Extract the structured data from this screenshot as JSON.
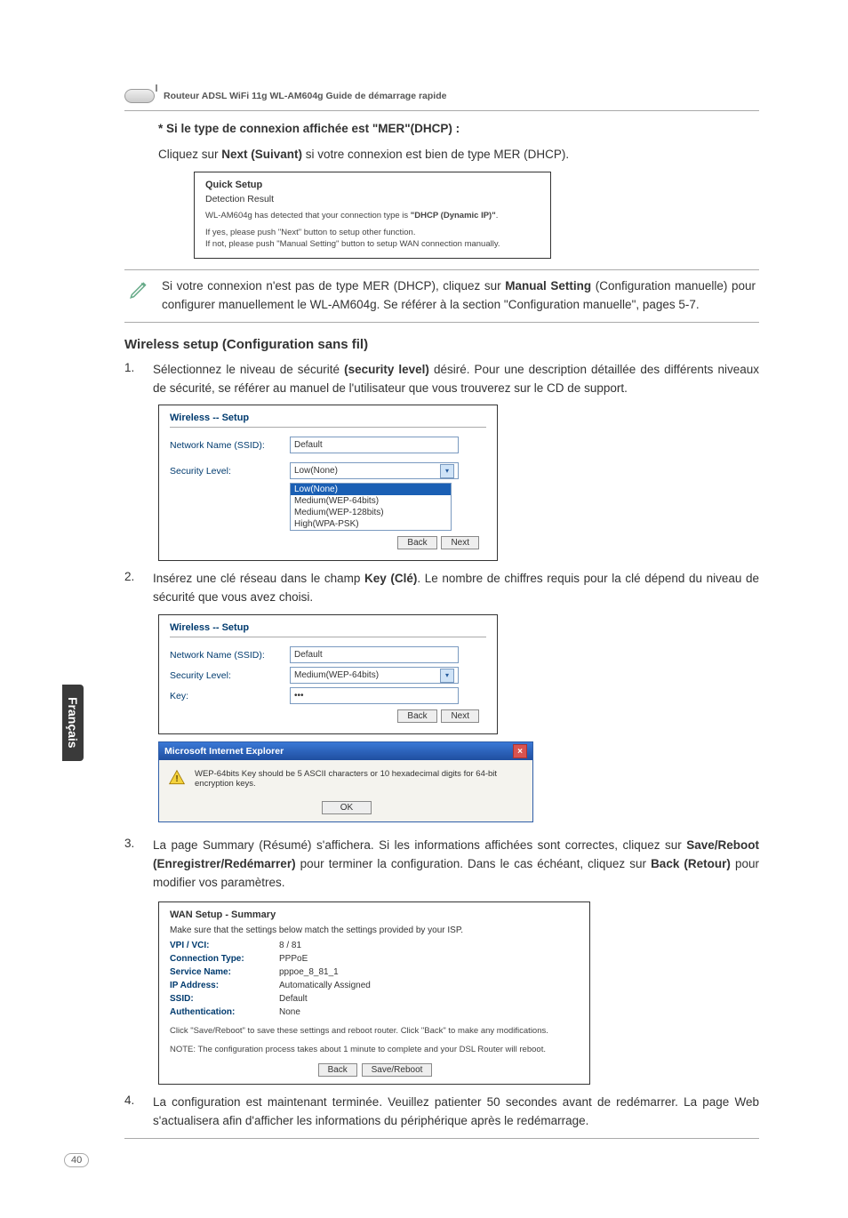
{
  "side_tab": "Français",
  "page_number": "40",
  "router_header": "Routeur ADSL WiFi 11g WL-AM604g Guide de démarrage rapide",
  "sec1": {
    "heading": "* Si le type de connexion affichée est  \"MER\"(DHCP) :",
    "line1_a": "Cliquez sur ",
    "line1_b": "Next (Suivant)",
    "line1_c": " si votre connexion est bien de type MER (DHCP)."
  },
  "qs1": {
    "title": "Quick Setup",
    "sub": "Detection Result",
    "msg_a": "WL-AM604g has detected that your connection type is ",
    "msg_b": "\"DHCP (Dynamic IP)\"",
    "msg_c": ".",
    "line2": "If yes, please push \"Next\" button to setup other function.",
    "line3": "If not, please push \"Manual Setting\" button to setup WAN connection manually."
  },
  "note1": {
    "t1": "Si votre connexion n'est pas de type MER (DHCP), cliquez sur ",
    "t2": "Manual Setting",
    "t3": " (Configuration manuelle) pour configurer manuellement le WL-AM604g. Se référer à la section \"Configuration manuelle\", pages 5-7."
  },
  "wsetup_heading": "Wireless setup (Configuration sans fil)",
  "step1": {
    "num": "1.",
    "t1": "Sélectionnez le niveau de sécurité ",
    "t2": "(security level)",
    "t3": " désiré. Pour une description détaillée des différents niveaux de sécurité, se référer au manuel de l'utilisateur que vous trouverez sur le CD de support."
  },
  "ws1": {
    "title": "Wireless -- Setup",
    "ssid_label": "Network Name (SSID):",
    "ssid_value": "Default",
    "seclevel_label": "Security Level:",
    "seclevel_value": "Low(None)",
    "opts": [
      "Low(None)",
      "Medium(WEP-64bits)",
      "Medium(WEP-128bits)",
      "High(WPA-PSK)"
    ],
    "back": "Back",
    "next": "Next"
  },
  "step2": {
    "num": "2.",
    "t1": "Insérez une clé réseau dans le champ ",
    "t2": "Key (Clé)",
    "t3": ". Le nombre de chiffres requis pour la clé dépend du niveau de sécurité que vous avez choisi."
  },
  "ws2": {
    "title": "Wireless -- Setup",
    "ssid_label": "Network Name (SSID):",
    "ssid_value": "Default",
    "seclevel_label": "Security Level:",
    "seclevel_value": "Medium(WEP-64bits)",
    "key_label": "Key:",
    "key_value": "•••",
    "back": "Back",
    "next": "Next"
  },
  "iedlg": {
    "title": "Microsoft Internet Explorer",
    "msg": "WEP-64bits Key should be 5 ASCII characters or 10 hexadecimal digits for 64-bit encryption keys.",
    "ok": "OK"
  },
  "step3": {
    "num": "3.",
    "t1": "La page Summary (Résumé) s'affichera. Si les informations affichées sont correctes, cliquez sur ",
    "t2": "Save/Reboot (Enregistrer/Redémarrer)",
    "t3": " pour terminer la configuration. Dans le cas échéant, cliquez sur ",
    "t4": "Back (Retour)",
    "t5": " pour modifier vos paramètres."
  },
  "summary": {
    "title": "WAN Setup - Summary",
    "intro": "Make sure that the settings below match the settings provided by your ISP.",
    "rows": [
      {
        "k": "VPI / VCI:",
        "v": "8 / 81"
      },
      {
        "k": "Connection Type:",
        "v": "PPPoE"
      },
      {
        "k": "Service Name:",
        "v": "pppoe_8_81_1"
      },
      {
        "k": "IP Address:",
        "v": "Automatically Assigned"
      },
      {
        "k": "SSID:",
        "v": "Default"
      },
      {
        "k": "Authentication:",
        "v": "None"
      }
    ],
    "note1": "Click \"Save/Reboot\" to save these settings and reboot router. Click \"Back\" to make any modifications.",
    "note2": "NOTE: The configuration process takes about 1 minute to complete and your DSL Router will reboot.",
    "back": "Back",
    "save": "Save/Reboot"
  },
  "step4": {
    "num": "4.",
    "text": "La configuration est maintenant terminée. Veuillez patienter 50 secondes avant de redémarrer. La page Web s'actualisera afin d'afficher les informations du périphérique après le redémarrage."
  }
}
